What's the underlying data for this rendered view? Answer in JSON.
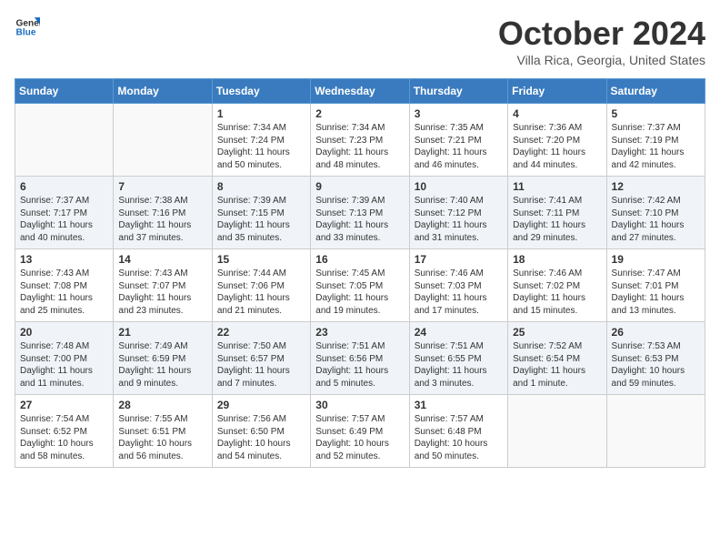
{
  "header": {
    "logo_line1": "General",
    "logo_line2": "Blue",
    "month_title": "October 2024",
    "location": "Villa Rica, Georgia, United States"
  },
  "days_of_week": [
    "Sunday",
    "Monday",
    "Tuesday",
    "Wednesday",
    "Thursday",
    "Friday",
    "Saturday"
  ],
  "weeks": [
    [
      {
        "day": "",
        "content": ""
      },
      {
        "day": "",
        "content": ""
      },
      {
        "day": "1",
        "content": "Sunrise: 7:34 AM\nSunset: 7:24 PM\nDaylight: 11 hours and 50 minutes."
      },
      {
        "day": "2",
        "content": "Sunrise: 7:34 AM\nSunset: 7:23 PM\nDaylight: 11 hours and 48 minutes."
      },
      {
        "day": "3",
        "content": "Sunrise: 7:35 AM\nSunset: 7:21 PM\nDaylight: 11 hours and 46 minutes."
      },
      {
        "day": "4",
        "content": "Sunrise: 7:36 AM\nSunset: 7:20 PM\nDaylight: 11 hours and 44 minutes."
      },
      {
        "day": "5",
        "content": "Sunrise: 7:37 AM\nSunset: 7:19 PM\nDaylight: 11 hours and 42 minutes."
      }
    ],
    [
      {
        "day": "6",
        "content": "Sunrise: 7:37 AM\nSunset: 7:17 PM\nDaylight: 11 hours and 40 minutes."
      },
      {
        "day": "7",
        "content": "Sunrise: 7:38 AM\nSunset: 7:16 PM\nDaylight: 11 hours and 37 minutes."
      },
      {
        "day": "8",
        "content": "Sunrise: 7:39 AM\nSunset: 7:15 PM\nDaylight: 11 hours and 35 minutes."
      },
      {
        "day": "9",
        "content": "Sunrise: 7:39 AM\nSunset: 7:13 PM\nDaylight: 11 hours and 33 minutes."
      },
      {
        "day": "10",
        "content": "Sunrise: 7:40 AM\nSunset: 7:12 PM\nDaylight: 11 hours and 31 minutes."
      },
      {
        "day": "11",
        "content": "Sunrise: 7:41 AM\nSunset: 7:11 PM\nDaylight: 11 hours and 29 minutes."
      },
      {
        "day": "12",
        "content": "Sunrise: 7:42 AM\nSunset: 7:10 PM\nDaylight: 11 hours and 27 minutes."
      }
    ],
    [
      {
        "day": "13",
        "content": "Sunrise: 7:43 AM\nSunset: 7:08 PM\nDaylight: 11 hours and 25 minutes."
      },
      {
        "day": "14",
        "content": "Sunrise: 7:43 AM\nSunset: 7:07 PM\nDaylight: 11 hours and 23 minutes."
      },
      {
        "day": "15",
        "content": "Sunrise: 7:44 AM\nSunset: 7:06 PM\nDaylight: 11 hours and 21 minutes."
      },
      {
        "day": "16",
        "content": "Sunrise: 7:45 AM\nSunset: 7:05 PM\nDaylight: 11 hours and 19 minutes."
      },
      {
        "day": "17",
        "content": "Sunrise: 7:46 AM\nSunset: 7:03 PM\nDaylight: 11 hours and 17 minutes."
      },
      {
        "day": "18",
        "content": "Sunrise: 7:46 AM\nSunset: 7:02 PM\nDaylight: 11 hours and 15 minutes."
      },
      {
        "day": "19",
        "content": "Sunrise: 7:47 AM\nSunset: 7:01 PM\nDaylight: 11 hours and 13 minutes."
      }
    ],
    [
      {
        "day": "20",
        "content": "Sunrise: 7:48 AM\nSunset: 7:00 PM\nDaylight: 11 hours and 11 minutes."
      },
      {
        "day": "21",
        "content": "Sunrise: 7:49 AM\nSunset: 6:59 PM\nDaylight: 11 hours and 9 minutes."
      },
      {
        "day": "22",
        "content": "Sunrise: 7:50 AM\nSunset: 6:57 PM\nDaylight: 11 hours and 7 minutes."
      },
      {
        "day": "23",
        "content": "Sunrise: 7:51 AM\nSunset: 6:56 PM\nDaylight: 11 hours and 5 minutes."
      },
      {
        "day": "24",
        "content": "Sunrise: 7:51 AM\nSunset: 6:55 PM\nDaylight: 11 hours and 3 minutes."
      },
      {
        "day": "25",
        "content": "Sunrise: 7:52 AM\nSunset: 6:54 PM\nDaylight: 11 hours and 1 minute."
      },
      {
        "day": "26",
        "content": "Sunrise: 7:53 AM\nSunset: 6:53 PM\nDaylight: 10 hours and 59 minutes."
      }
    ],
    [
      {
        "day": "27",
        "content": "Sunrise: 7:54 AM\nSunset: 6:52 PM\nDaylight: 10 hours and 58 minutes."
      },
      {
        "day": "28",
        "content": "Sunrise: 7:55 AM\nSunset: 6:51 PM\nDaylight: 10 hours and 56 minutes."
      },
      {
        "day": "29",
        "content": "Sunrise: 7:56 AM\nSunset: 6:50 PM\nDaylight: 10 hours and 54 minutes."
      },
      {
        "day": "30",
        "content": "Sunrise: 7:57 AM\nSunset: 6:49 PM\nDaylight: 10 hours and 52 minutes."
      },
      {
        "day": "31",
        "content": "Sunrise: 7:57 AM\nSunset: 6:48 PM\nDaylight: 10 hours and 50 minutes."
      },
      {
        "day": "",
        "content": ""
      },
      {
        "day": "",
        "content": ""
      }
    ]
  ]
}
